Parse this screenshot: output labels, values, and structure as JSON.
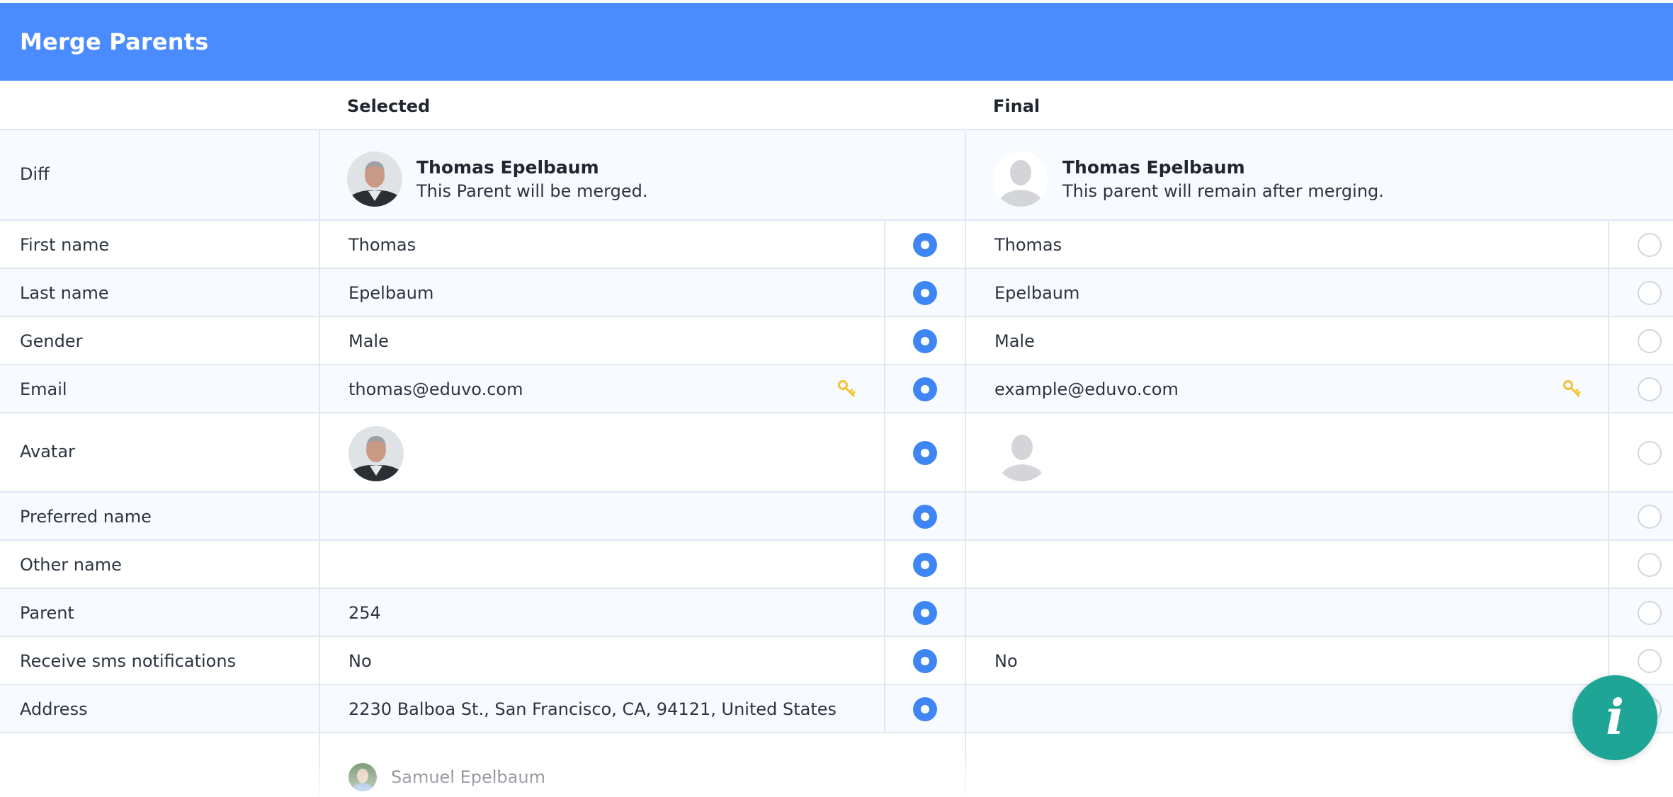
{
  "header": {
    "title": "Merge Parents"
  },
  "columns": {
    "selected": "Selected",
    "final": "Final"
  },
  "diff": {
    "label": "Diff",
    "selected_name": "Thomas Epelbaum",
    "selected_note": "This Parent will be merged.",
    "final_name": "Thomas Epelbaum",
    "final_note": "This parent will remain after merging."
  },
  "rows": [
    {
      "label": "First name",
      "selected": "Thomas",
      "final": "Thomas"
    },
    {
      "label": "Last name",
      "selected": "Epelbaum",
      "final": "Epelbaum"
    },
    {
      "label": "Gender",
      "selected": "Male",
      "final": "Male"
    },
    {
      "label": "Email",
      "selected": "thomas@eduvo.com",
      "final": "example@eduvo.com"
    },
    {
      "label": "Avatar",
      "selected": "",
      "final": ""
    },
    {
      "label": "Preferred name",
      "selected": "",
      "final": ""
    },
    {
      "label": "Other name",
      "selected": "",
      "final": ""
    },
    {
      "label": "Parent",
      "selected": "254",
      "final": ""
    },
    {
      "label": "Receive sms notifications",
      "selected": "No",
      "final": "No"
    },
    {
      "label": "Address",
      "selected": "2230 Balboa St., San Francisco, CA, 94121, United States",
      "final": ""
    }
  ],
  "children": {
    "selected_first": "Samuel Epelbaum"
  },
  "colors": {
    "header": "#4a8cff",
    "radio_on": "#3f86f5",
    "key": "#f2c232",
    "info": "#1fa596"
  }
}
